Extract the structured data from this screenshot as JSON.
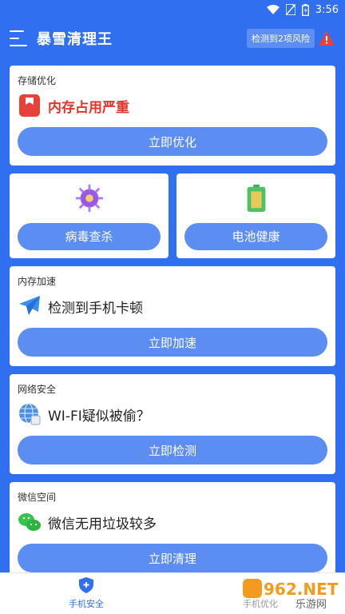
{
  "status": {
    "time": "3:56"
  },
  "header": {
    "title": "暴雪清理王",
    "risk_badge": "检测到2项风险"
  },
  "cards": {
    "storage": {
      "label": "存储优化",
      "title": "内存占用严重",
      "button": "立即优化"
    },
    "virus": {
      "button": "病毒查杀"
    },
    "battery": {
      "button": "电池健康"
    },
    "memory": {
      "label": "内存加速",
      "title": "检测到手机卡顿",
      "button": "立即加速"
    },
    "network": {
      "label": "网络安全",
      "title": "WI-FI疑似被偷？",
      "button": "立即检测"
    },
    "wechat": {
      "label": "微信空间",
      "title": "微信无用垃圾较多",
      "button": "立即清理"
    }
  },
  "nav": {
    "item1": "手机安全",
    "item2": "手机优化"
  },
  "watermark": {
    "text": "962.NET",
    "subtext": "乐游网"
  },
  "colors": {
    "brand": "#2f6ff0",
    "button": "#5b8df2",
    "alert": "#e0342c"
  },
  "icons": [
    "menu-icon",
    "warning-icon",
    "storage-icon",
    "virus-icon",
    "battery-icon",
    "plane-icon",
    "globe-icon",
    "wechat-icon",
    "shield-icon"
  ]
}
